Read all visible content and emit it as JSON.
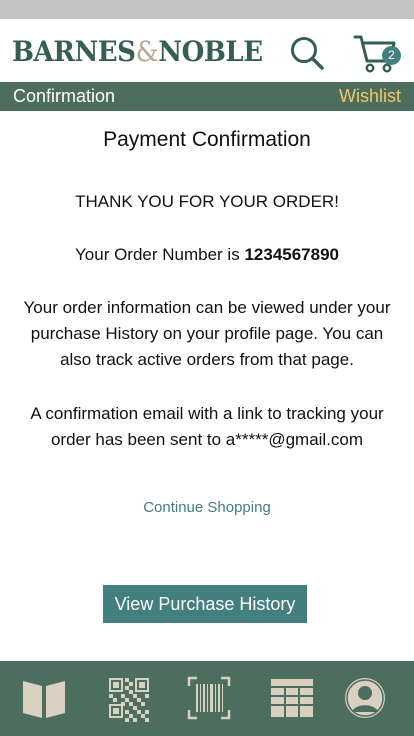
{
  "header": {
    "logo_text_left": "BARNES",
    "logo_amp": "&",
    "logo_text_right": "NOBLE",
    "cart_count": "2",
    "brand_color": "#355f51",
    "accent_color": "#437f7e"
  },
  "subbar": {
    "title": "Confirmation",
    "wishlist_label": "Wishlist"
  },
  "content": {
    "heading": "Payment Confirmation",
    "thanks": "THANK YOU FOR YOUR ORDER!",
    "order_prefix": "Your Order Number is",
    "order_number": "1234567890",
    "info": "Your order information can be viewed under your purchase History on your profile page. You can also track active orders from that page.",
    "email_note": "A confirmation email with a link to tracking your order has been sent to a*****@gmail.com",
    "continue_label": "Continue Shopping",
    "history_button_label": "View Purchase History"
  },
  "tabbar": {
    "icons": [
      "book-icon",
      "qr-code-icon",
      "barcode-icon",
      "grid-icon",
      "profile-icon"
    ]
  }
}
